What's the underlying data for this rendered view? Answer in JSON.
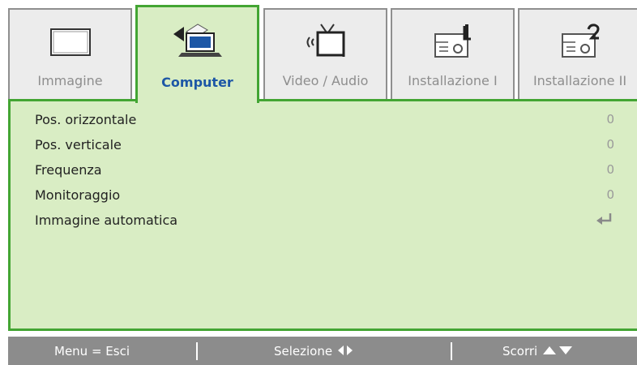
{
  "tabs": [
    {
      "label": "Immagine",
      "icon": "picture-icon",
      "active": false
    },
    {
      "label": "Computer",
      "icon": "computer-icon",
      "active": true
    },
    {
      "label": "Video / Audio",
      "icon": "tv-audio-icon",
      "active": false
    },
    {
      "label": "Installazione I",
      "icon": "projector-icon",
      "active": false
    },
    {
      "label": "Installazione II",
      "icon": "projector-2-icon",
      "active": false
    }
  ],
  "menu": {
    "items": [
      {
        "label": "Pos. orizzontale",
        "value": "0"
      },
      {
        "label": "Pos. verticale",
        "value": "0"
      },
      {
        "label": "Frequenza",
        "value": "0"
      },
      {
        "label": "Monitoraggio",
        "value": "0"
      },
      {
        "label": "Immagine automatica",
        "value_icon": "enter-icon"
      }
    ]
  },
  "footer": {
    "menu_exit": "Menu = Esci",
    "select": "Selezione",
    "scroll": "Scorri"
  },
  "colors": {
    "accent_green": "#43a533",
    "panel_bg": "#d9edc4",
    "active_label": "#1d57a6",
    "footer_bg": "#8c8c8c"
  }
}
